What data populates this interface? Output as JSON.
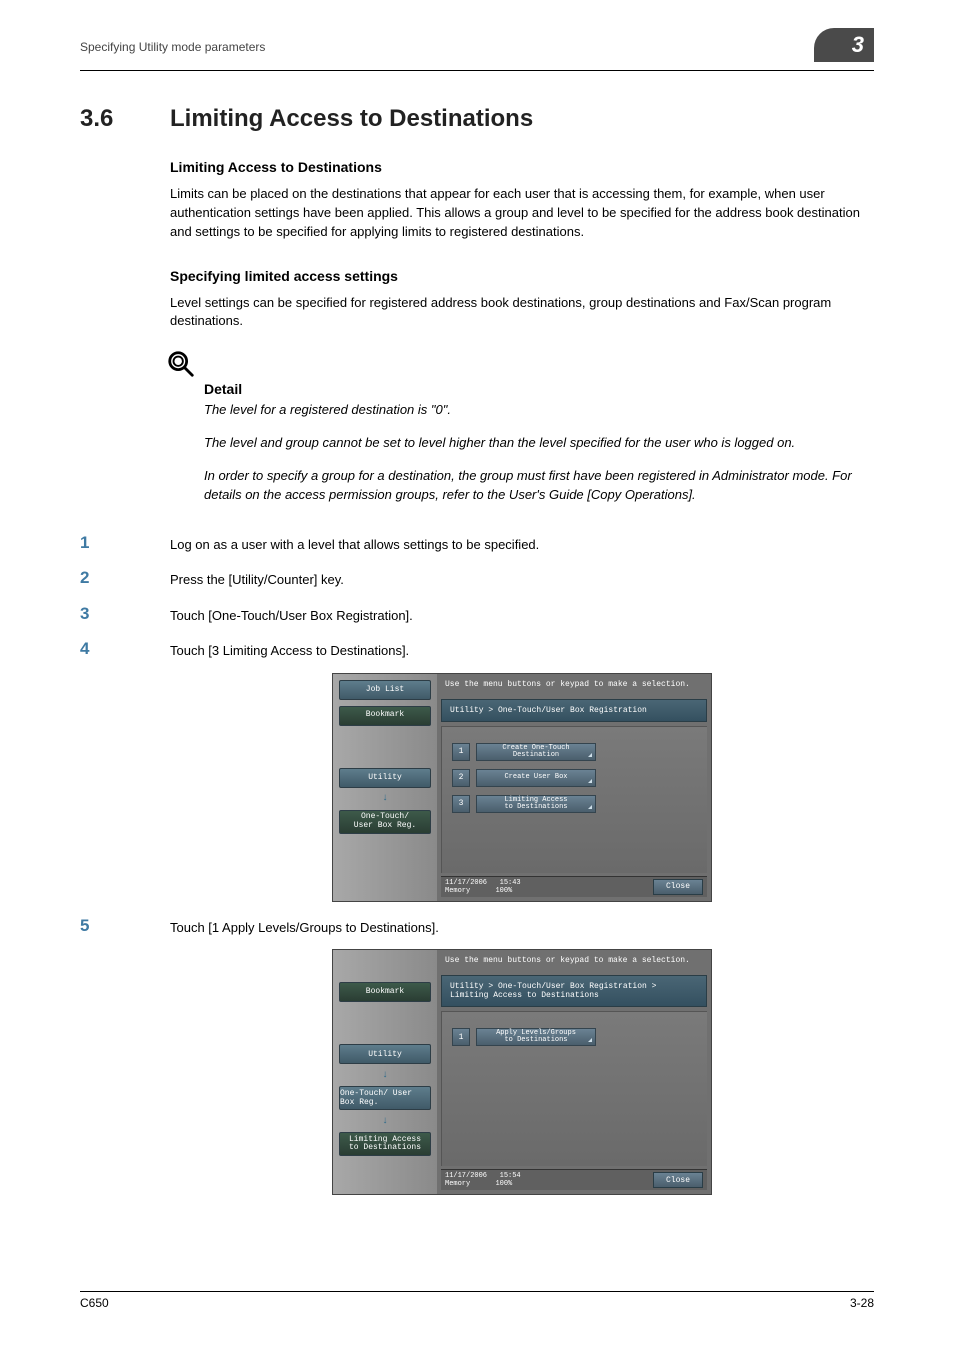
{
  "header": {
    "running": "Specifying Utility mode parameters",
    "chapter": "3"
  },
  "section": {
    "number": "3.6",
    "title": "Limiting Access to Destinations"
  },
  "sub1": {
    "heading": "Limiting Access to Destinations",
    "p1": "Limits can be placed on the destinations that appear for each user that is accessing them, for example, when user authentication settings have been applied. This allows a group and level to be specified for the address book destination and settings to be specified for applying limits to registered destinations."
  },
  "sub2": {
    "heading": "Specifying limited access settings",
    "p1": "Level settings can be specified for registered address book destinations, group destinations and Fax/Scan program destinations."
  },
  "detail": {
    "label": "Detail",
    "p1": "The level for a registered destination is \"0\".",
    "p2": "The level and group cannot be set to level higher than the level specified for the user who is logged on.",
    "p3": "In order to specify a group for a destination, the group must first have been registered in Administrator mode. For details on the access permission groups, refer to the User's Guide [Copy Operations]."
  },
  "steps": {
    "s1": {
      "n": "1",
      "t": "Log on as a user with a level that allows settings to be specified."
    },
    "s2": {
      "n": "2",
      "t": "Press the [Utility/Counter] key."
    },
    "s3": {
      "n": "3",
      "t": "Touch [One-Touch/User Box Registration]."
    },
    "s4": {
      "n": "4",
      "t": "Touch [3 Limiting Access to Destinations]."
    },
    "s5": {
      "n": "5",
      "t": "Touch [1 Apply Levels/Groups to Destinations]."
    }
  },
  "shot1": {
    "top": "Use the menu buttons or keypad to make a selection.",
    "crumb": "Utility > One-Touch/User Box Registration",
    "side": {
      "joblist": "Job List",
      "bookmark": "Bookmark",
      "utility": "Utility",
      "onetouch": "One-Touch/\nUser Box Reg."
    },
    "items": [
      {
        "n": "1",
        "label": "Create One-Touch\nDestination"
      },
      {
        "n": "2",
        "label": "Create User Box"
      },
      {
        "n": "3",
        "label": "Limiting Access\nto Destinations"
      }
    ],
    "footer": {
      "date": "11/17/2006",
      "time": "15:43",
      "mem": "Memory",
      "memval": "100%",
      "close": "Close"
    }
  },
  "shot2": {
    "top": "Use the menu buttons or keypad to make a selection.",
    "crumb": "Utility > One-Touch/User Box Registration > Limiting Access to Destinations",
    "side": {
      "bookmark": "Bookmark",
      "utility": "Utility",
      "onetouch": "One-Touch/\nUser Box Reg.",
      "limiting": "Limiting Access\nto Destinations"
    },
    "items": [
      {
        "n": "1",
        "label": "Apply Levels/Groups\nto Destinations"
      }
    ],
    "footer": {
      "date": "11/17/2006",
      "time": "15:54",
      "mem": "Memory",
      "memval": "100%",
      "close": "Close"
    }
  },
  "footer": {
    "left": "C650",
    "right": "3-28"
  }
}
